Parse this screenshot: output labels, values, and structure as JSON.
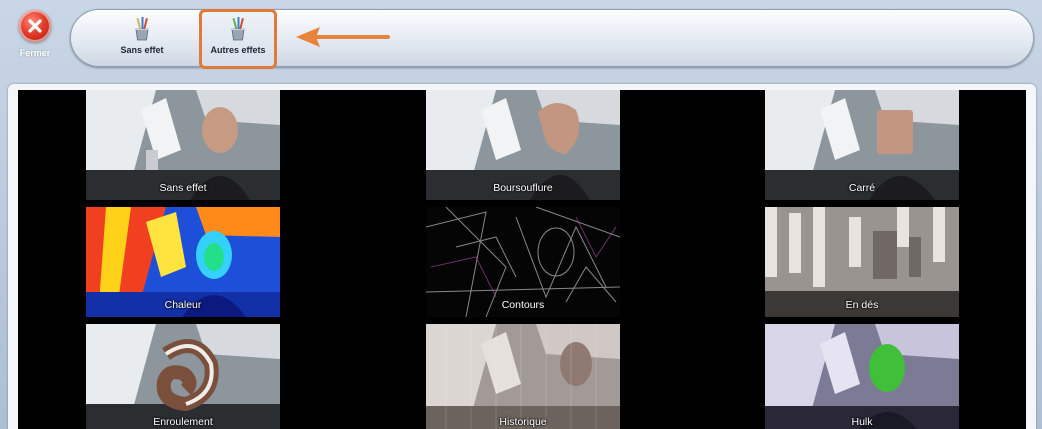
{
  "close": {
    "label": "Fermer",
    "icon": "close-icon"
  },
  "toolbar": {
    "buttons": [
      {
        "label": "Sans effet",
        "icon": "brush-cup-icon"
      },
      {
        "label": "Autres effets",
        "icon": "brush-cup-icon",
        "highlighted": true
      }
    ]
  },
  "colors": {
    "highlight": "#e07a3a",
    "arrow": "#e8833d",
    "close_red": "#e23b2a"
  },
  "effects": [
    {
      "label": "Sans effet"
    },
    {
      "label": "Boursouflure"
    },
    {
      "label": "Carré"
    },
    {
      "label": "Chaleur"
    },
    {
      "label": "Contours"
    },
    {
      "label": "En dés"
    },
    {
      "label": "Enroulement"
    },
    {
      "label": "Historique"
    },
    {
      "label": "Hulk"
    }
  ]
}
